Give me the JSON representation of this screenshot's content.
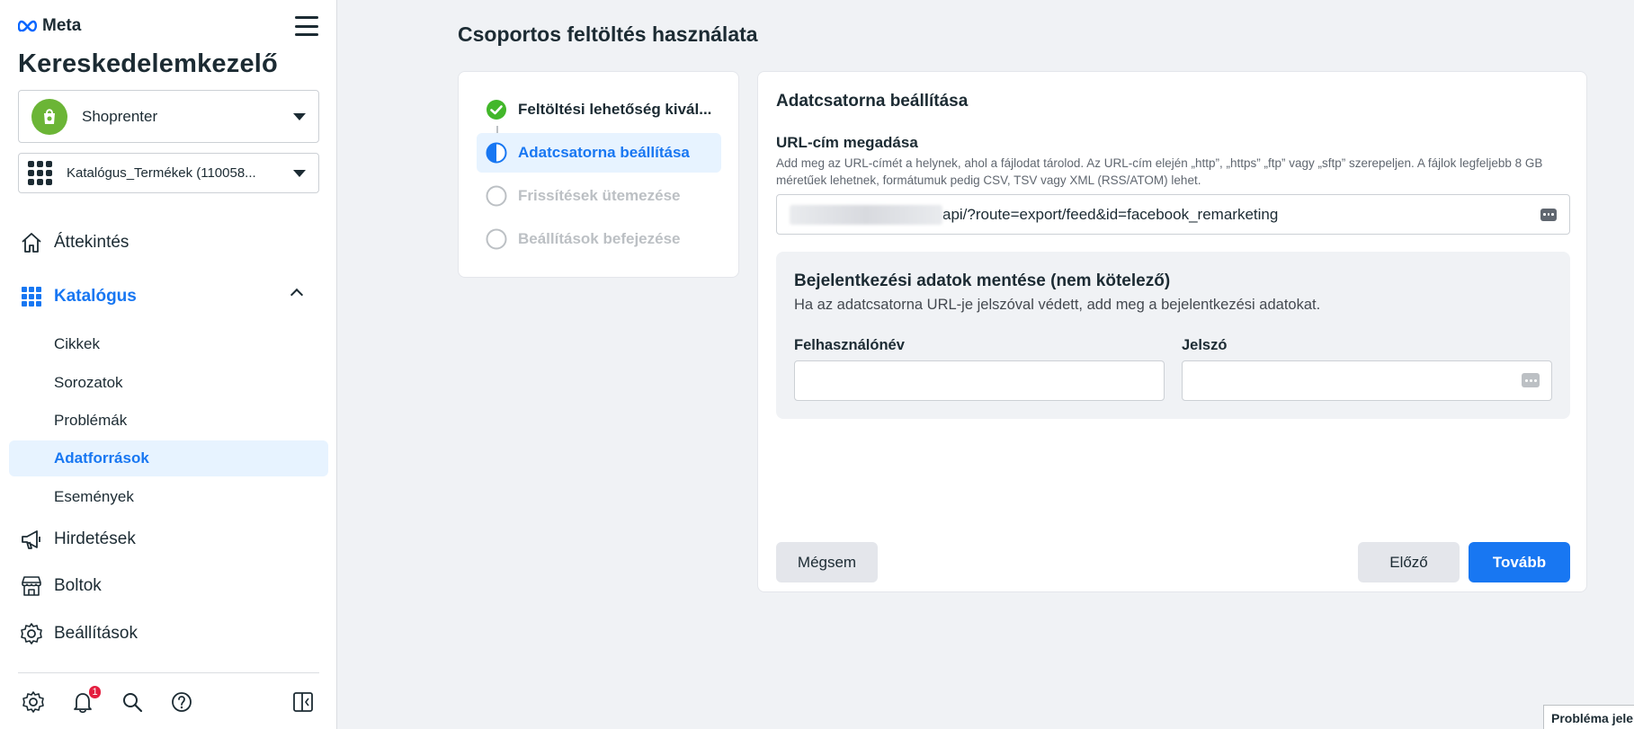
{
  "brand": {
    "name": "Meta"
  },
  "app": {
    "title": "Kereskedelemkezelő"
  },
  "account": {
    "name": "Shoprenter"
  },
  "catalog": {
    "name": "Katalógus_Termékek (110058..."
  },
  "nav": {
    "overview": "Áttekintés",
    "catalog": "Katalógus",
    "catalog_sub": [
      "Cikkek",
      "Sorozatok",
      "Problémák",
      "Adatforrások",
      "Események"
    ],
    "ads": "Hirdetések",
    "shops": "Boltok",
    "settings": "Beállítások"
  },
  "notifications": {
    "count": "1"
  },
  "page": {
    "title": "Csoportos feltöltés használata"
  },
  "steps": [
    {
      "label": "Feltöltési lehetőség kivál...",
      "state": "done"
    },
    {
      "label": "Adatcsatorna beállítása",
      "state": "current"
    },
    {
      "label": "Frissítések ütemezése",
      "state": "pending"
    },
    {
      "label": "Beállítások befejezése",
      "state": "pending"
    }
  ],
  "form": {
    "section_title": "Adatcsatorna beállítása",
    "url_title": "URL-cím megadása",
    "url_desc": "Add meg az URL-címét a helynek, ahol a fájlodat tárolod. Az URL-cím elején „http”, „https” „ftp” vagy „sftp” szerepeljen. A fájlok legfeljebb 8 GB méretűek lehetnek, formátumuk pedig CSV, TSV vagy XML (RSS/ATOM) lehet.",
    "url_value": "api/?route=export/feed&id=facebook_remarketing",
    "login_title": "Bejelentkezési adatok mentése (nem kötelező)",
    "login_desc": "Ha az adatcsatorna URL-je jelszóval védett, add meg a bejelentkezési adatokat.",
    "username_label": "Felhasználónév",
    "username_value": "",
    "password_label": "Jelszó",
    "password_value": ""
  },
  "buttons": {
    "cancel": "Mégsem",
    "previous": "Előző",
    "next": "Tovább"
  },
  "footer": {
    "report": "Probléma jelentése"
  },
  "colors": {
    "accent": "#1877f2",
    "success": "#42b72a",
    "badge": "#e41e3f"
  }
}
